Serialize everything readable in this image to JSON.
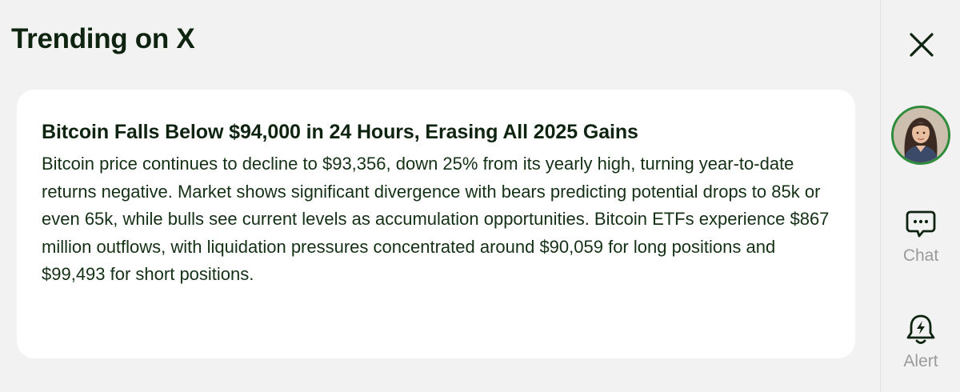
{
  "panel": {
    "title": "Trending on X"
  },
  "trend": {
    "headline": "Bitcoin Falls Below $94,000 in 24 Hours, Erasing All 2025 Gains",
    "body": "Bitcoin price continues to decline to $93,356, down 25% from its yearly high, turning year-to-date returns negative. Market shows significant divergence with bears predicting potential drops to 85k or even 65k, while bulls see current levels as accumulation opportunities. Bitcoin ETFs experience $867 million outflows, with liquidation pressures concentrated around $90,059 for long positions and $99,493 for short positions."
  },
  "sidebar": {
    "close_icon": "close-icon",
    "avatar_icon": "user-avatar",
    "chat": {
      "label": "Chat",
      "icon": "chat-bubble-icon"
    },
    "alert": {
      "label": "Alert",
      "icon": "bell-lightning-icon"
    }
  },
  "colors": {
    "background": "#f2f2f2",
    "card": "#ffffff",
    "text_dark_green": "#0f2410",
    "avatar_ring": "#2e8b3a",
    "muted_label": "#9b9b9b"
  }
}
